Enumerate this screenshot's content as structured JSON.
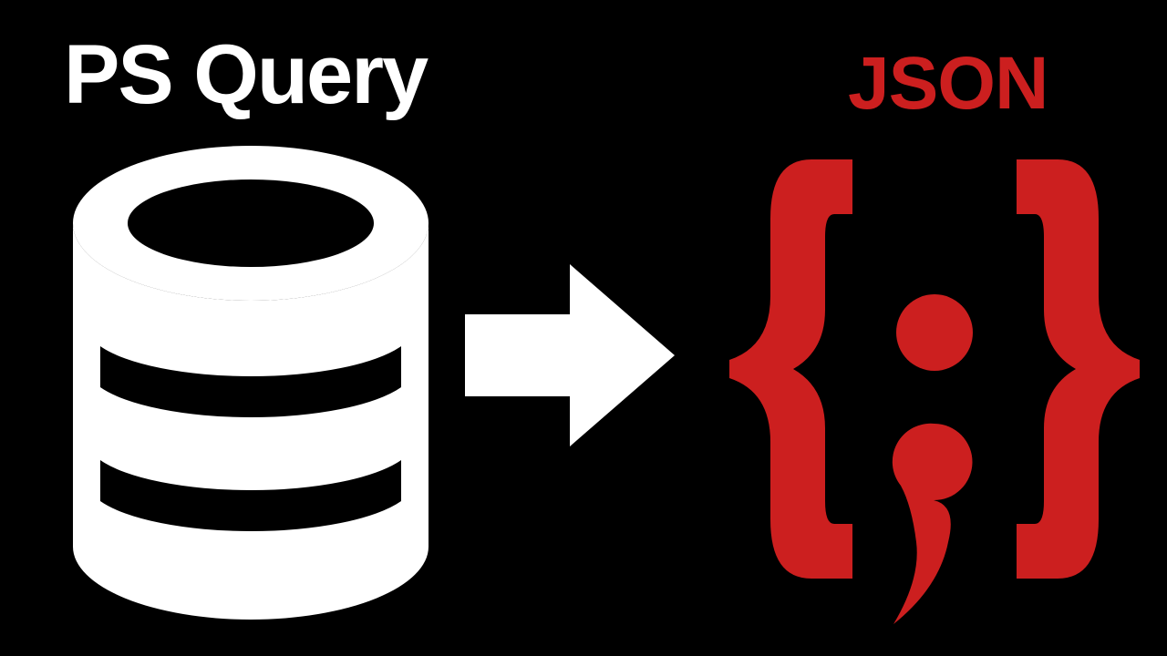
{
  "labels": {
    "left": "PS Query",
    "right": "JSON"
  },
  "colors": {
    "background": "#000000",
    "left_text": "#ffffff",
    "right_text": "#cc1f1f",
    "database_icon": "#ffffff",
    "arrow_icon": "#ffffff",
    "json_icon": "#cc1f1f"
  },
  "icons": {
    "left": "database-icon",
    "middle": "arrow-right-icon",
    "right": "json-braces-icon"
  }
}
